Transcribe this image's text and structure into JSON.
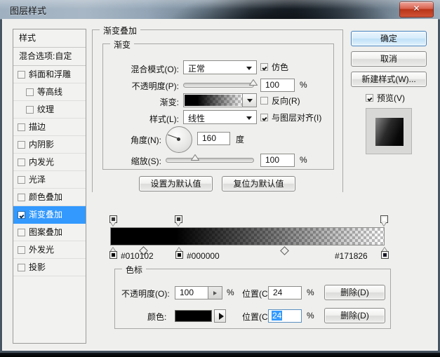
{
  "window": {
    "title": "图层样式",
    "close_label": "✕"
  },
  "styles_panel": {
    "header": "样式",
    "blending_options": "混合选项:自定",
    "items": [
      {
        "label": "斜面和浮雕",
        "checked": false,
        "indent": false,
        "selected": false
      },
      {
        "label": "等高线",
        "checked": false,
        "indent": true,
        "selected": false
      },
      {
        "label": "纹理",
        "checked": false,
        "indent": true,
        "selected": false
      },
      {
        "label": "描边",
        "checked": false,
        "indent": false,
        "selected": false
      },
      {
        "label": "内阴影",
        "checked": false,
        "indent": false,
        "selected": false
      },
      {
        "label": "内发光",
        "checked": false,
        "indent": false,
        "selected": false
      },
      {
        "label": "光泽",
        "checked": false,
        "indent": false,
        "selected": false
      },
      {
        "label": "颜色叠加",
        "checked": false,
        "indent": false,
        "selected": false
      },
      {
        "label": "渐变叠加",
        "checked": true,
        "indent": false,
        "selected": true
      },
      {
        "label": "图案叠加",
        "checked": false,
        "indent": false,
        "selected": false
      },
      {
        "label": "外发光",
        "checked": false,
        "indent": false,
        "selected": false
      },
      {
        "label": "投影",
        "checked": false,
        "indent": false,
        "selected": false
      }
    ]
  },
  "overlay_group": {
    "title": "渐变叠加",
    "gradient_group_title": "渐变",
    "blend_mode": {
      "label": "混合模式(O):",
      "value": "正常"
    },
    "dither": {
      "label": "仿色",
      "checked": true
    },
    "opacity": {
      "label": "不透明度(P):",
      "value": "100",
      "unit": "%",
      "percent": 100
    },
    "gradient": {
      "label": "渐变:"
    },
    "reverse": {
      "label": "反向(R)",
      "checked": false
    },
    "style": {
      "label": "样式(L):",
      "value": "线性"
    },
    "align_with_layer": {
      "label": "与图层对齐(I)",
      "checked": true
    },
    "angle": {
      "label": "角度(N):",
      "value": "160",
      "unit": "度",
      "degrees": 160
    },
    "scale": {
      "label": "缩放(S):",
      "value": "100",
      "unit": "%",
      "percent": 100
    },
    "set_default_button": "设置为默认值",
    "reset_default_button": "复位为默认值"
  },
  "gradient_editor": {
    "opacity_stops": [
      {
        "position_pct": 1,
        "opacity": 100
      },
      {
        "position_pct": 24,
        "opacity": 100
      },
      {
        "position_pct": 100,
        "opacity": 0
      }
    ],
    "color_stops": [
      {
        "position_pct": 1,
        "hex": "#010102",
        "label": "#010102"
      },
      {
        "position_pct": 24,
        "hex": "#000000",
        "label": "#000000"
      },
      {
        "position_pct": 100,
        "hex": "#171826",
        "label": "#171826"
      }
    ],
    "midpoints": [
      {
        "position_pct": 12
      },
      {
        "position_pct": 62
      }
    ]
  },
  "color_stop_group": {
    "title": "色标",
    "opacity": {
      "label": "不透明度(O):",
      "value": "100",
      "unit": "%"
    },
    "opacity_position": {
      "label": "位置(C):",
      "value": "24",
      "unit": "%"
    },
    "opacity_delete": "删除(D)",
    "color": {
      "label": "颜色:",
      "hex": "#000000"
    },
    "color_position": {
      "label": "位置(C):",
      "value": "24",
      "unit": "%",
      "selected": true
    },
    "color_delete": "删除(D)"
  },
  "action_buttons": {
    "ok": "确定",
    "cancel": "取消",
    "new_style": "新建样式(W)...",
    "preview": {
      "label": "预览(V)",
      "checked": true
    }
  },
  "colors": {
    "accent": "#3399ff",
    "dialog_bg": "#efefed",
    "close_red": "#b93418"
  }
}
